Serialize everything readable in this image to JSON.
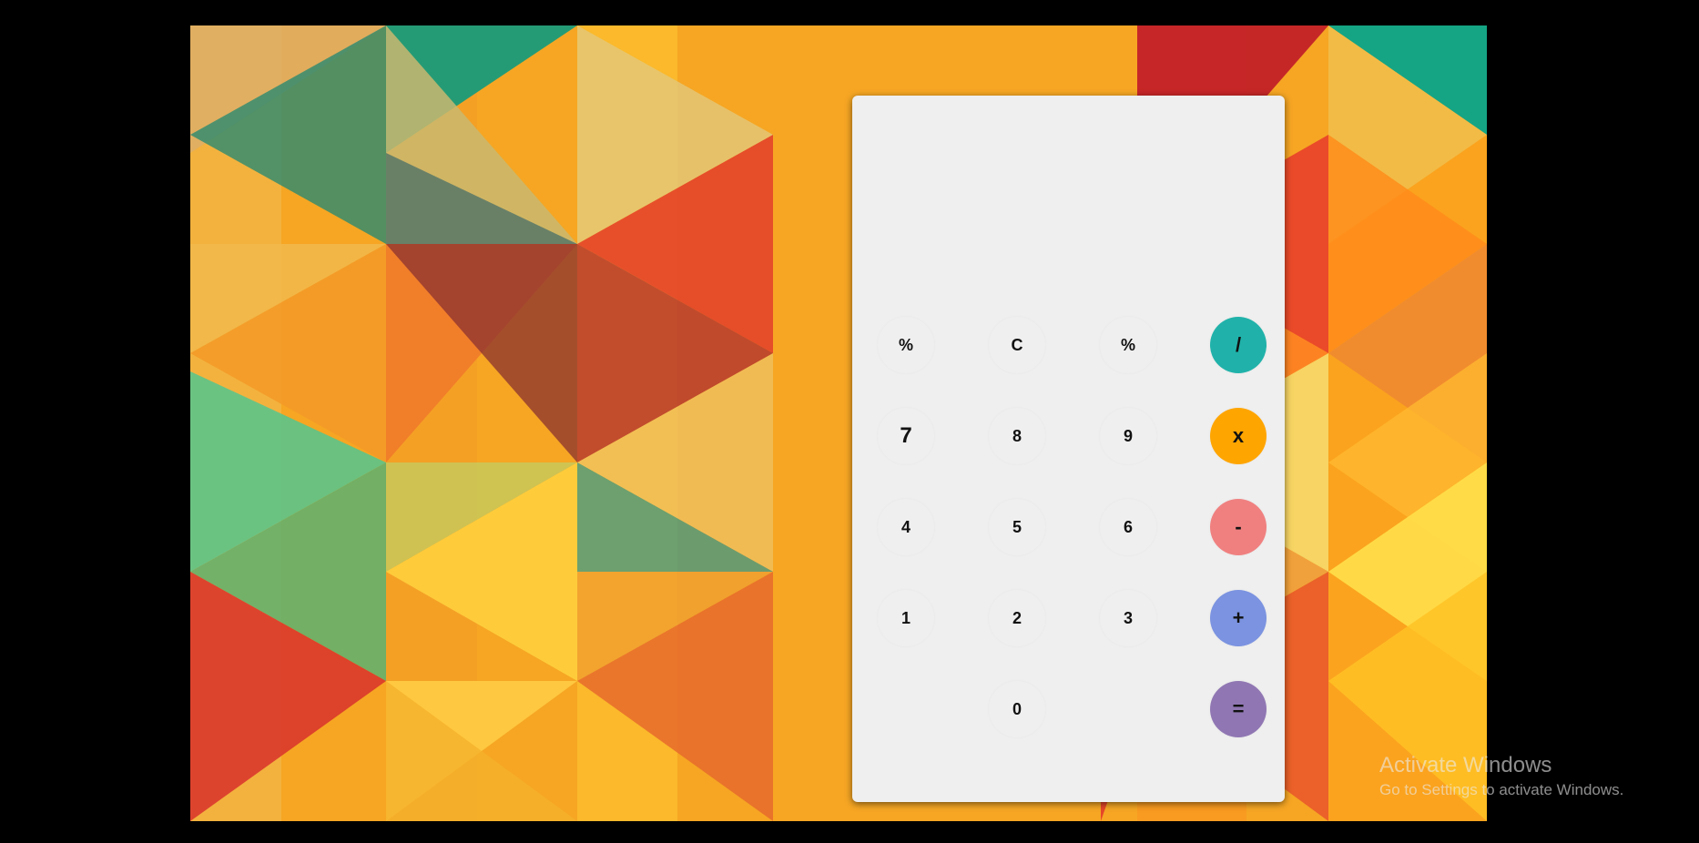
{
  "calculator": {
    "display_value": "",
    "keys": {
      "percent_left": "%",
      "clear": "C",
      "percent": "%",
      "divide": "/",
      "seven": "7",
      "eight": "8",
      "nine": "9",
      "multiply": "x",
      "four": "4",
      "five": "5",
      "six": "6",
      "subtract": "-",
      "one": "1",
      "two": "2",
      "three": "3",
      "add": "+",
      "zero": "0",
      "equals": "="
    },
    "colors": {
      "panel": "#efefef",
      "divide": "#20b2aa",
      "multiply": "#ffa500",
      "subtract": "#f08080",
      "add": "#7b93e0",
      "equals": "#9077b3"
    }
  },
  "watermark": {
    "title": "Activate Windows",
    "subtitle": "Go to Settings to activate Windows."
  },
  "background": {
    "palette": [
      "#f5a623",
      "#e8412a",
      "#0aa58a",
      "#ffd23f",
      "#f7dc6f",
      "#fb7c1f",
      "#b81c2a",
      "#6cc07a"
    ]
  }
}
